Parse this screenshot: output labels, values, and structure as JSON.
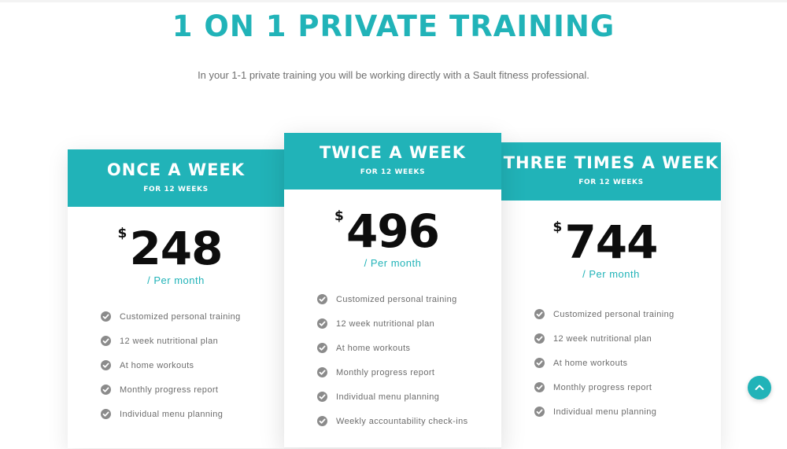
{
  "page": {
    "title": "1 ON 1 PRIVATE TRAINING",
    "subtitle": "In your 1-1 private training you will be working directly with a Sault fitness professional."
  },
  "colors": {
    "accent": "#21b3b8",
    "price_text": "#0d0d0d",
    "feature_text": "#6c6c6c",
    "check_icon": "#8b8b8b"
  },
  "plans": [
    {
      "name": "ONCE A WEEK",
      "duration": "FOR 12 WEEKS",
      "currency": "$",
      "price": "248",
      "period": "/ Per month",
      "features": [
        "Customized personal training",
        "12 week nutritional plan",
        "At home workouts",
        "Monthly progress report",
        "Individual menu planning"
      ]
    },
    {
      "name": "TWICE A WEEK",
      "duration": "FOR 12 WEEKS",
      "currency": "$",
      "price": "496",
      "period": "/ Per month",
      "features": [
        "Customized personal training",
        "12 week nutritional plan",
        "At home workouts",
        "Monthly progress report",
        "Individual menu planning",
        "Weekly accountability check-ins"
      ]
    },
    {
      "name": "THREE TIMES A WEEK",
      "duration": "FOR 12 WEEKS",
      "currency": "$",
      "price": "744",
      "period": "/ Per month",
      "features": [
        "Customized personal training",
        "12 week nutritional plan",
        "At home workouts",
        "Monthly progress report",
        "Individual menu planning"
      ]
    }
  ],
  "icons": {
    "feature_check": "check-circle-icon",
    "scroll_top": "chevron-up-icon"
  }
}
